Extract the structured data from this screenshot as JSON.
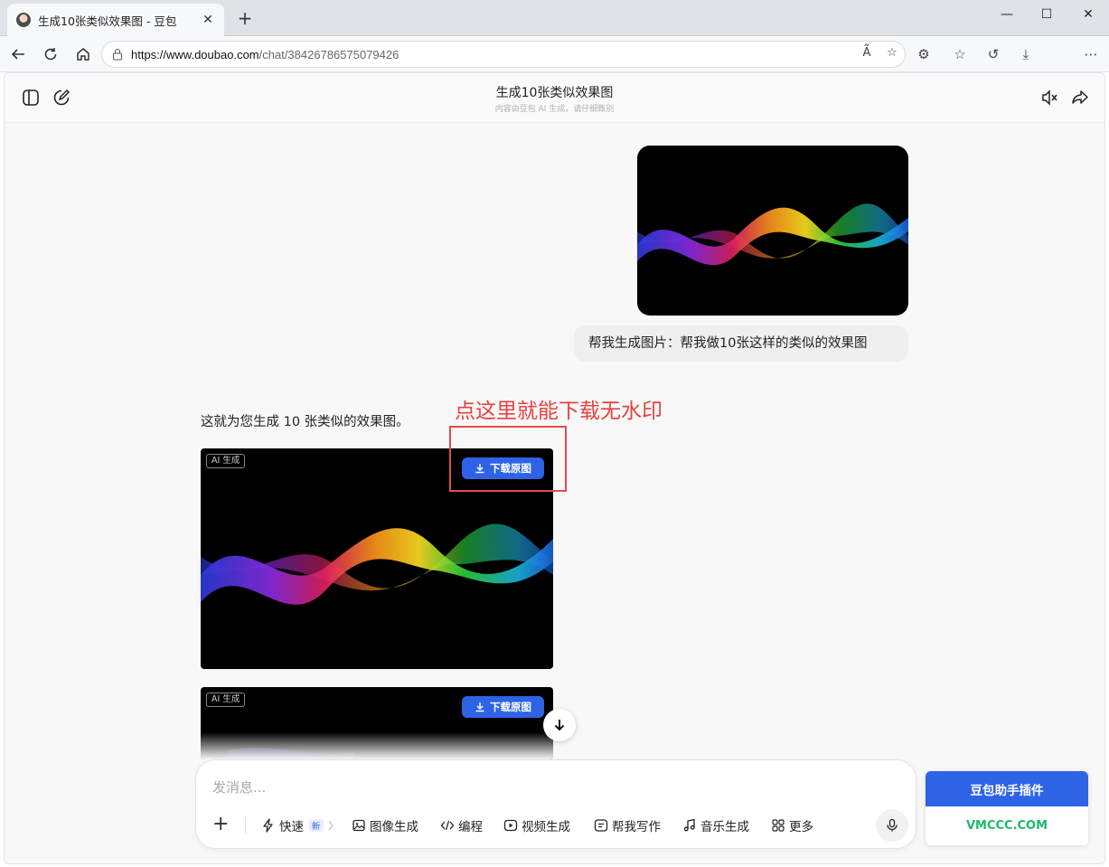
{
  "browser": {
    "tab_title": "生成10张类似效果图 - 豆包",
    "url_host": "https://www.doubao.com",
    "url_path": "/chat/38426786575079426"
  },
  "header": {
    "title": "生成10张类似效果图",
    "subtitle": "内容由豆包 AI 生成，请仔细甄别"
  },
  "conversation": {
    "user_message": "帮我生成图片：帮我做10张这样的类似的效果图",
    "reply_text": "这就为您生成 10 张类似的效果图。",
    "ai_label": "AI 生成",
    "download_label": "下载原图"
  },
  "annotation": {
    "text": "点这里就能下载无水印",
    "color": "#e8413f"
  },
  "composer": {
    "placeholder": "发消息...",
    "tools": [
      {
        "label": "快速",
        "icon": "lightning-icon"
      },
      {
        "label": "图像生成",
        "icon": "image-icon"
      },
      {
        "label": "编程",
        "icon": "code-icon"
      },
      {
        "label": "视频生成",
        "icon": "video-icon"
      },
      {
        "label": "帮我写作",
        "icon": "writing-icon"
      },
      {
        "label": "音乐生成",
        "icon": "music-icon"
      },
      {
        "label": "更多",
        "icon": "grid-icon"
      }
    ],
    "new_badge": "新"
  },
  "plugin": {
    "title": "豆包助手插件",
    "watermark": "VMCCC.COM"
  },
  "colors": {
    "accent": "#2e63e6",
    "annotation_red": "#e14b4b",
    "watermark_green": "#1fb86b"
  }
}
